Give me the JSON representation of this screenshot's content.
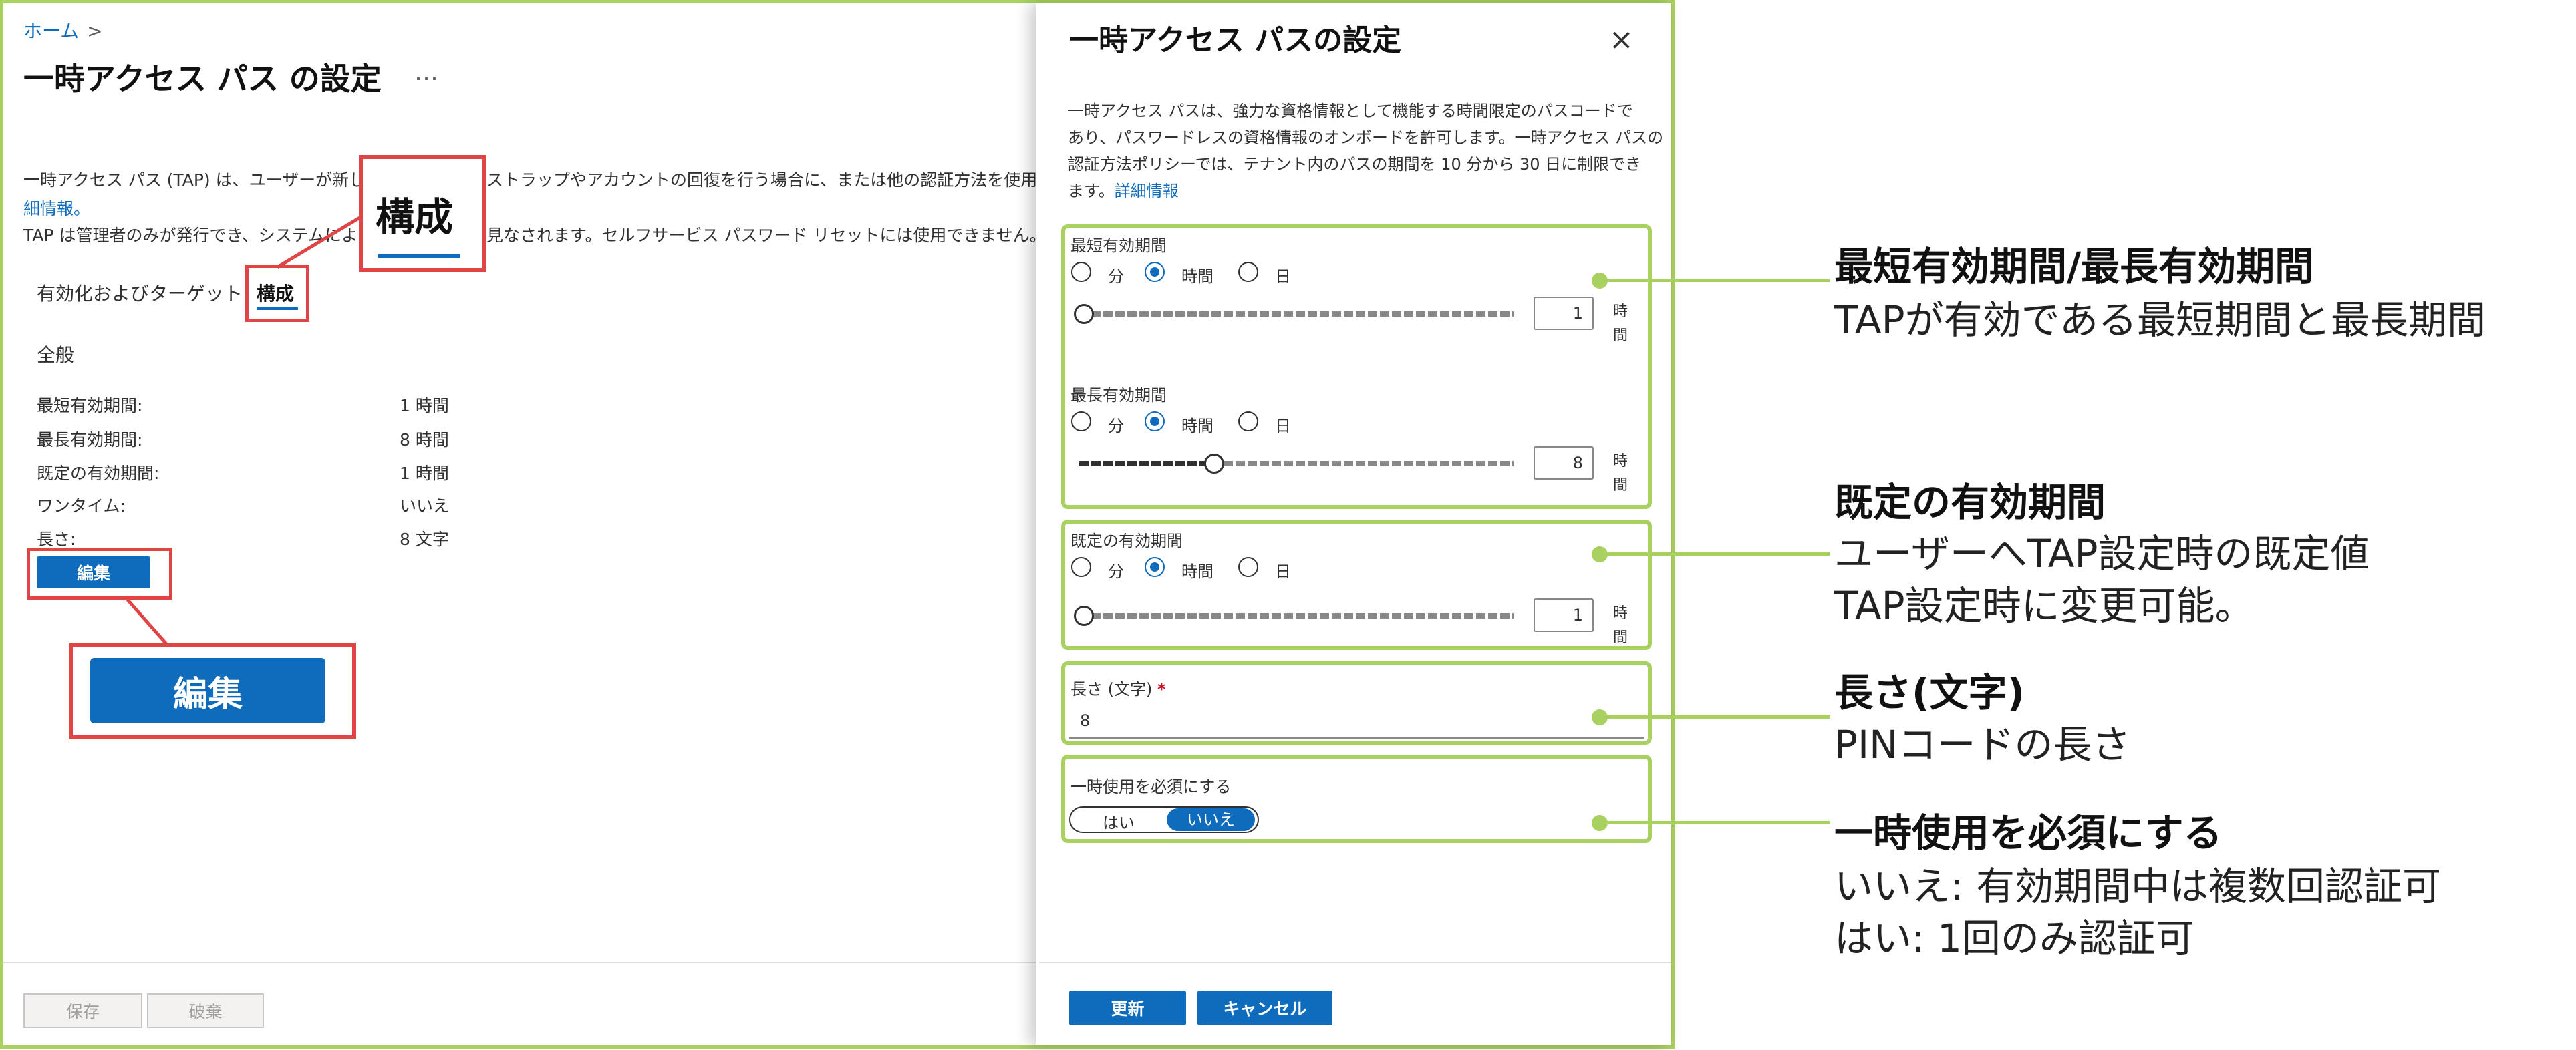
{
  "left_blade": {
    "breadcrumb_home": "ホーム",
    "breadcrumb_sep": ">",
    "title": "一時アクセス パス の設定",
    "more": "…",
    "desc_line1_a": "一時アクセス パス (TAP) は、ユーザーが新しい",
    "desc_line1_b": "ストラップやアカウントの回復を行う場合に、または他の認証方法を使用でき",
    "desc_line2_link": "細情報。",
    "desc_line3_a": "TAP は管理者のみが発行でき、システムによっ",
    "desc_line3_b": "見なされます。セルフサービス パスワード リセットには使用できません。",
    "tabs": [
      {
        "label": "有効化およびターゲット"
      },
      {
        "label": "構成"
      }
    ],
    "general_heading": "全般",
    "properties": [
      {
        "label": "最短有効期間:",
        "value": "1 時間"
      },
      {
        "label": "最長有効期間:",
        "value": "8 時間"
      },
      {
        "label": "既定の有効期間:",
        "value": "1 時間"
      },
      {
        "label": "ワンタイム:",
        "value": "いいえ"
      },
      {
        "label": "長さ:",
        "value": "8 文字"
      }
    ],
    "edit_label": "編集",
    "zoom_config_label": "構成",
    "zoom_edit_label": "編集",
    "save_label": "保存",
    "discard_label": "破棄"
  },
  "panel": {
    "title": "一時アクセス パスの設定",
    "close": "×",
    "desc_lines": [
      "一時アクセス パスは、強力な資格情報として機能する時間限定のパスコードで",
      "あり、パスワードレスの資格情報のオンボードを許可します。一時アクセス パスの",
      "認証方法ポリシーでは、テナント内のパスの期間を 10 分から 30 日に制限でき"
    ],
    "desc_last_prefix": "ます。",
    "desc_link": "詳細情報",
    "radio_labels": {
      "minutes": "分",
      "hours": "時間",
      "days": "日"
    },
    "unit_hour_top": "時",
    "unit_hour_bottom": "間",
    "min_lifetime": {
      "label": "最短有効期間",
      "value": "1",
      "fraction": 0.0
    },
    "max_lifetime": {
      "label": "最長有効期間",
      "value": "8",
      "fraction": 0.31
    },
    "default_lifetime": {
      "label": "既定の有効期間",
      "value": "1",
      "fraction": 0.0
    },
    "length": {
      "label": "長さ (文字)",
      "required_mark": "*",
      "value": "8"
    },
    "one_time": {
      "label": "一時使用を必須にする",
      "yes": "はい",
      "no": "いいえ",
      "selected": "いいえ"
    },
    "update_label": "更新",
    "cancel_label": "キャンセル"
  },
  "annotations": [
    {
      "title": "最短有効期間/最長有効期間",
      "lines": [
        "TAPが有効である最短期間と最長期間"
      ]
    },
    {
      "title": "既定の有効期間",
      "lines": [
        "ユーザーへTAP設定時の既定値",
        "TAP設定時に変更可能。"
      ]
    },
    {
      "title": "長さ(文字)",
      "lines": [
        "PINコードの長さ"
      ]
    },
    {
      "title": "一時使用を必須にする",
      "lines": [
        "いいえ: 有効期間中は複数回認証可",
        "はい: 1回のみ認証可"
      ]
    }
  ],
  "colors": {
    "accent": "#0f6cbd",
    "highlight_red": "#e04545",
    "annotation_green": "#a9d160"
  }
}
